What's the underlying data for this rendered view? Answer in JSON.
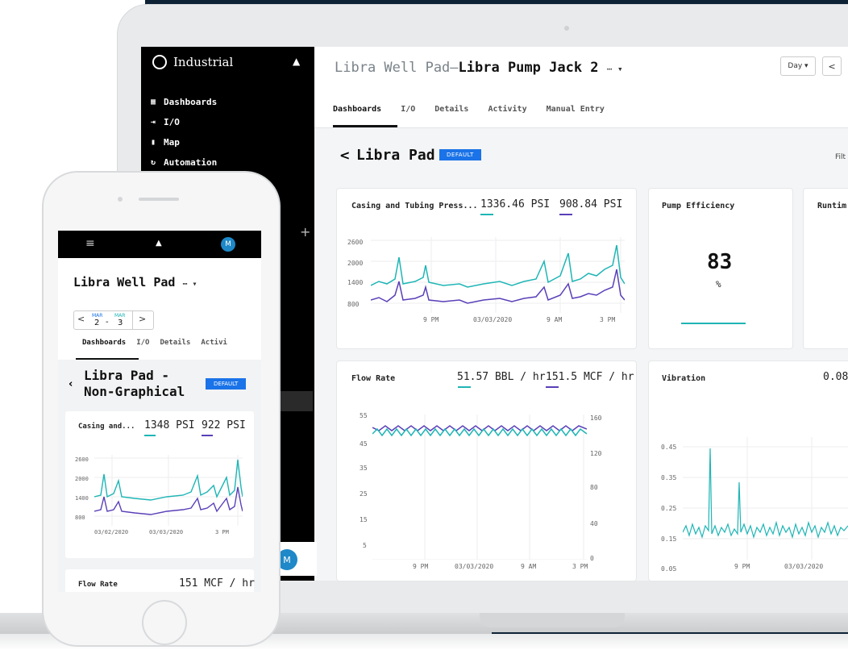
{
  "app": {
    "brand": "Industrial",
    "nav": [
      {
        "icon": "dashboards-icon",
        "glyph": "▦",
        "label": "Dashboards"
      },
      {
        "icon": "io-icon",
        "glyph": "⇥",
        "label": "I/O"
      },
      {
        "icon": "map-icon",
        "glyph": "▮",
        "label": "Map"
      },
      {
        "icon": "automation-icon",
        "glyph": "↻",
        "label": "Automation"
      }
    ],
    "avatar": "M"
  },
  "header": {
    "title_prefix": "Libra Well Pad—",
    "title_main": "Libra Pump Jack 2",
    "more": "⋯ ▾",
    "tabs": [
      "Dashboards",
      "I/O",
      "Details",
      "Activity",
      "Manual Entry"
    ],
    "day_label": "Day ▾",
    "prev_label": "<"
  },
  "dashboard": {
    "back": "<",
    "name": "Libra Pad",
    "badge": "DEFAULT",
    "filter_label": "Filt"
  },
  "cards": {
    "pressure": {
      "title": "Casing and Tubing Press...",
      "value1": "1336.46 PSI",
      "value2": "908.84 PSI",
      "yticks": [
        "2600",
        "2000",
        "1400",
        "800"
      ],
      "xticks": [
        "9 PM",
        "03/03/2020",
        "9 AM",
        "3 PM"
      ]
    },
    "efficiency": {
      "title": "Pump Efficiency",
      "value": "83",
      "unit": "%"
    },
    "runtime": {
      "title": "Runtim"
    },
    "flow": {
      "title": "Flow Rate",
      "value1": "51.57 BBL / hr",
      "value2": "151.5 MCF / hr",
      "yticks_left": [
        "55",
        "45",
        "35",
        "25",
        "15",
        "5"
      ],
      "yticks_right": [
        "160",
        "120",
        "80",
        "40",
        "0"
      ],
      "xticks": [
        "9 PM",
        "03/03/2020",
        "9 AM",
        "3 PM"
      ]
    },
    "vibration": {
      "title": "Vibration",
      "value": "0.08",
      "yticks": [
        "0.45",
        "0.35",
        "0.25",
        "0.15",
        "0.05"
      ],
      "xticks": [
        "9 PM",
        "03/03/2020"
      ]
    }
  },
  "mobile": {
    "avatar": "M",
    "title": "Libra Well Pad",
    "more": "⋯ ▾",
    "date_from_month": "MAR",
    "date_from_day": "2",
    "date_to_month": "MAR",
    "date_to_day": "3",
    "date_sep": "-",
    "tabs": [
      "Dashboards",
      "I/O",
      "Details",
      "Activi"
    ],
    "pad_line1": "Libra Pad -",
    "pad_line2": "Non-Graphical",
    "badge": "DEFAULT",
    "pressure": {
      "title": "Casing and...",
      "value1": "1348 PSI",
      "value2": "922 PSI",
      "yticks": [
        "2600",
        "2000",
        "1400",
        "800"
      ],
      "xticks": [
        "03/02/2020",
        "03/03/2020",
        "3 PM"
      ]
    },
    "flow": {
      "title": "Flow Rate",
      "value": "151 MCF / hr"
    }
  },
  "colors": {
    "teal": "#1fb5b5",
    "purple": "#5a3fb8",
    "accent": "#1a73e8"
  }
}
